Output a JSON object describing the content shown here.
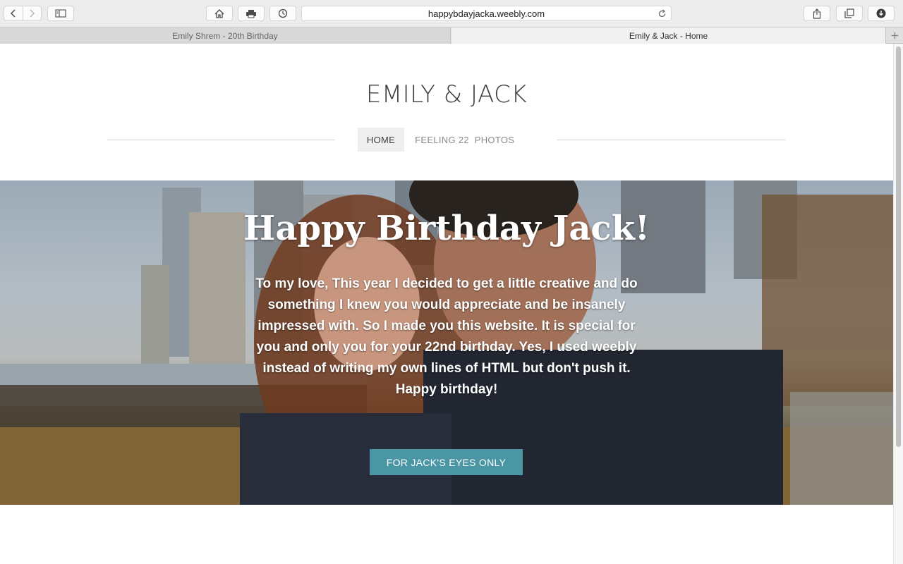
{
  "browser": {
    "url": "happybdayjacka.weebly.com",
    "tabs": [
      {
        "label": "Emily Shrem - 20th Birthday",
        "active": false
      },
      {
        "label": "Emily & Jack - Home",
        "active": true
      }
    ],
    "toolbar_icons": [
      "back-icon",
      "forward-icon",
      "sidebar-icon",
      "home-icon",
      "print-icon",
      "history-icon",
      "reload-icon",
      "share-icon",
      "tabs-overview-icon",
      "download-icon",
      "new-tab-icon"
    ]
  },
  "site": {
    "title": "EMILY & JACK",
    "nav": [
      {
        "label": "HOME",
        "active": true
      },
      {
        "label": "FEELING 22",
        "active": false
      },
      {
        "label": "PHOTOS",
        "active": false
      }
    ]
  },
  "hero": {
    "title": "Happy Birthday Jack!",
    "body": "To my love, This year I decided to get a little creative and do something I knew you would appreciate and be insanely impressed with. So I made you this website. It is special for you and only you for your 22nd birthday. Yes, I used weebly instead of writing my own lines of HTML but don't push it.",
    "closing": "Happy birthday!",
    "button_label": "FOR JACK'S EYES ONLY"
  },
  "colors": {
    "button": "#4a96a4",
    "title_text": "#3e3e3e",
    "nav_active_bg": "#efefef"
  }
}
